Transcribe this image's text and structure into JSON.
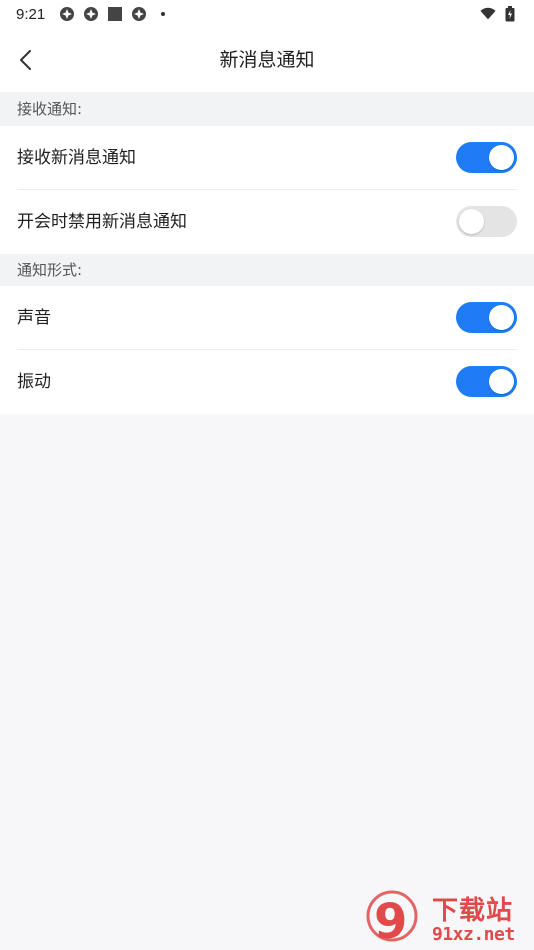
{
  "status_bar": {
    "time": "9:21",
    "left_icons": [
      "notification-icon",
      "notification-icon",
      "square-icon",
      "notification-icon"
    ],
    "right_icons": [
      "wifi-icon",
      "battery-icon"
    ]
  },
  "header": {
    "title": "新消息通知",
    "back_icon": "chevron-left-icon"
  },
  "sections": [
    {
      "title": "接收通知:",
      "items": [
        {
          "label": "接收新消息通知",
          "enabled": true
        },
        {
          "label": "开会时禁用新消息通知",
          "enabled": false
        }
      ]
    },
    {
      "title": "通知形式:",
      "items": [
        {
          "label": "声音",
          "enabled": true
        },
        {
          "label": "振动",
          "enabled": true
        }
      ]
    }
  ],
  "watermark": {
    "cn": "下载站",
    "domain": "91xz.net",
    "logo_text": "9"
  },
  "colors": {
    "accent": "#1f7cf5",
    "toggle_off": "#e4e4e4",
    "background": "#f7f7f9",
    "section_bg": "#f2f3f5",
    "watermark": "#e04a4a"
  }
}
